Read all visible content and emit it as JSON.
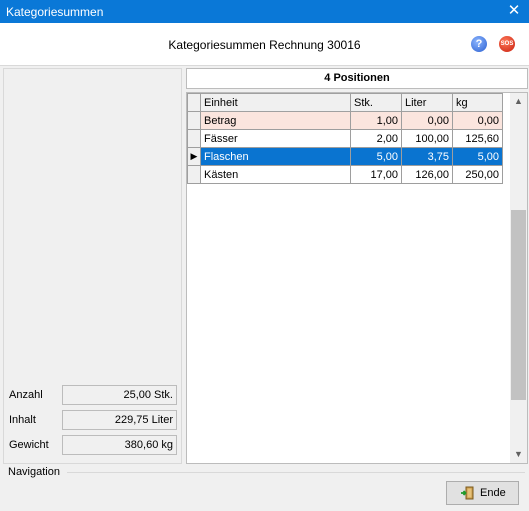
{
  "window": {
    "title": "Kategoriesummen",
    "close_glyph": "✕"
  },
  "header": {
    "heading": "Kategoriesummen Rechnung 30016",
    "help_icon": "?",
    "sos_icon": "SOS"
  },
  "stats": [
    {
      "label": "Anzahl",
      "value": "25,00 Stk."
    },
    {
      "label": "Inhalt",
      "value": "229,75 Liter"
    },
    {
      "label": "Gewicht",
      "value": "380,60 kg"
    }
  ],
  "positions": {
    "label": "4 Positionen"
  },
  "table": {
    "columns": [
      "Einheit",
      "Stk.",
      "Liter",
      "kg"
    ],
    "rows": [
      [
        "Betrag",
        "1,00",
        "0,00",
        "0,00"
      ],
      [
        "Fässer",
        "2,00",
        "100,00",
        "125,60"
      ],
      [
        "Flaschen",
        "5,00",
        "3,75",
        "5,00"
      ],
      [
        "Kästen",
        "17,00",
        "126,00",
        "250,00"
      ]
    ],
    "selected_row": 2,
    "colors": {
      "selected": "#0a74d0",
      "betrag_row": "#fbe5de"
    }
  },
  "navigation": {
    "label": "Navigation"
  },
  "buttons": {
    "ende": "Ende"
  },
  "colors": {
    "titlebar": "#0a78d7"
  }
}
